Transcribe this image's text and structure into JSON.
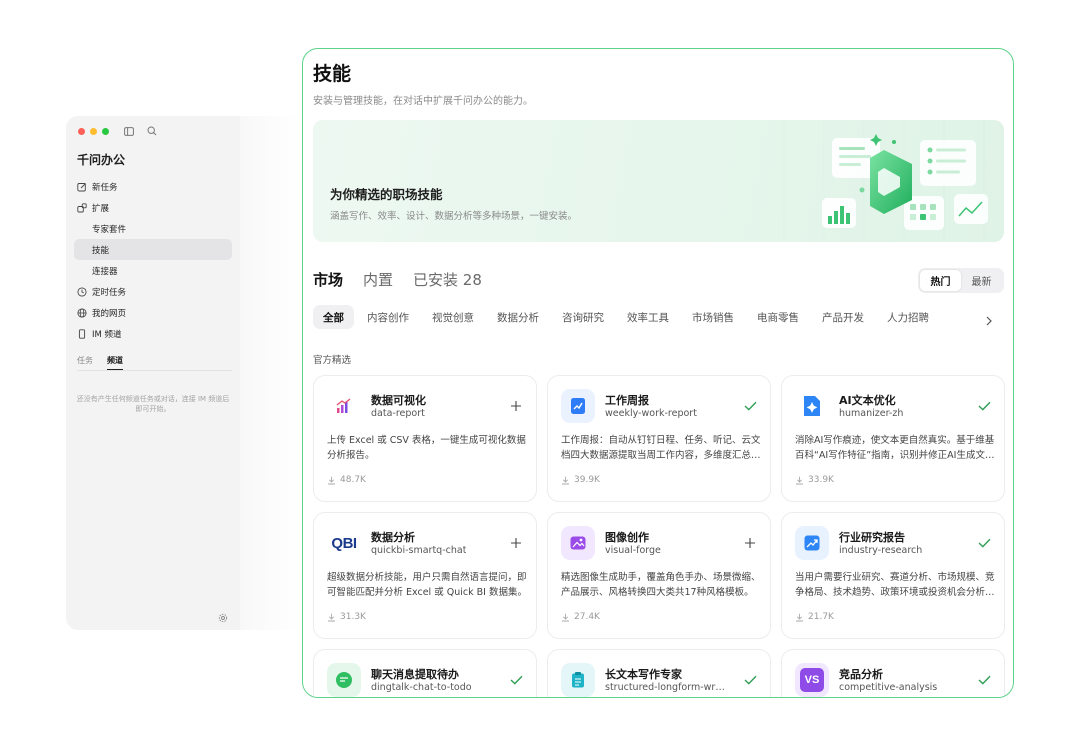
{
  "sidebar": {
    "app_title": "千问办公",
    "nav": [
      {
        "label": "新任务",
        "icon": "edit-icon"
      },
      {
        "label": "扩展",
        "icon": "extension-icon"
      },
      {
        "label": "专家套件",
        "sub": true
      },
      {
        "label": "技能",
        "sub": true,
        "active": true
      },
      {
        "label": "连接器",
        "sub": true
      },
      {
        "label": "定时任务",
        "icon": "clock-icon"
      },
      {
        "label": "我的网页",
        "icon": "globe-icon"
      },
      {
        "label": "IM 频道",
        "icon": "phone-icon"
      }
    ],
    "tabs": [
      "任务",
      "频道"
    ],
    "active_tab": "频道",
    "empty_text": "还没有产生任何频道任务或对话，连接 IM 频道后即可开始。"
  },
  "main": {
    "title": "技能",
    "subtitle": "安装与管理技能，在对话中扩展千问办公的能力。",
    "banner": {
      "title": "为你精选的职场技能",
      "subtitle": "涵盖写作、效率、设计、数据分析等多种场景，一键安装。"
    },
    "tabs": [
      {
        "label": "市场",
        "active": true
      },
      {
        "label": "内置"
      },
      {
        "label": "已安装 28"
      }
    ],
    "sort": {
      "hot": "热门",
      "latest": "最新"
    },
    "categories": [
      "全部",
      "内容创作",
      "视觉创意",
      "数据分析",
      "咨询研究",
      "效率工具",
      "市场销售",
      "电商零售",
      "产品开发",
      "人力招聘"
    ],
    "section_label": "官方精选",
    "cards": [
      {
        "name": "数据可视化",
        "slug": "data-report",
        "desc": "上传 Excel 或 CSV 表格，一键生成可视化数据分析报告。",
        "downloads": "48.7K",
        "installed": false,
        "icon": "chart-bars-icon"
      },
      {
        "name": "工作周报",
        "slug": "weekly-work-report",
        "desc": "工作周报：自动从钉钉日程、任务、听记、云文档四大数据源提取当周工作内容，多维度汇总生成周报。",
        "downloads": "39.9K",
        "installed": true,
        "icon": "trend-doc-icon"
      },
      {
        "name": "AI文本优化",
        "slug": "humanizer-zh",
        "desc": "消除AI写作痕迹，使文本更自然真实。基于维基百科“AI写作特征”指南，识别并修正AI生成文本。",
        "downloads": "33.9K",
        "installed": true,
        "icon": "sparkle-doc-icon"
      },
      {
        "name": "数据分析",
        "slug": "quickbi-smartq-chat",
        "desc": "超级数据分析技能，用户只需自然语言提问，即可智能匹配并分析 Excel 或 Quick BI 数据集。",
        "downloads": "31.3K",
        "installed": false,
        "icon": "qbi-logo-icon",
        "logo_text": "QBI"
      },
      {
        "name": "图像创作",
        "slug": "visual-forge",
        "desc": "精选图像生成助手，覆盖角色手办、场景微缩、产品展示、风格转换四大类共17种风格模板。",
        "downloads": "27.4K",
        "installed": false,
        "icon": "image-icon"
      },
      {
        "name": "行业研究报告",
        "slug": "industry-research",
        "desc": "当用户需要行业研究、赛道分析、市场规模、竞争格局、技术趋势、政策环境或投资机会分析时使用。",
        "downloads": "21.7K",
        "installed": true,
        "icon": "trend-up-icon"
      },
      {
        "name": "聊天消息提取待办",
        "slug": "dingtalk-chat-to-todo",
        "desc": "",
        "downloads": "",
        "installed": true,
        "icon": "chat-icon"
      },
      {
        "name": "长文本写作专家",
        "slug": "structured-longform-writing",
        "desc": "",
        "downloads": "",
        "installed": true,
        "icon": "clipboard-icon"
      },
      {
        "name": "竞品分析",
        "slug": "competitive-analysis",
        "desc": "",
        "downloads": "",
        "installed": true,
        "icon": "vs-icon",
        "logo_text": "VS"
      }
    ]
  },
  "colors": {
    "accent_green": "#5ed38a",
    "check_green": "#2f9e55"
  }
}
